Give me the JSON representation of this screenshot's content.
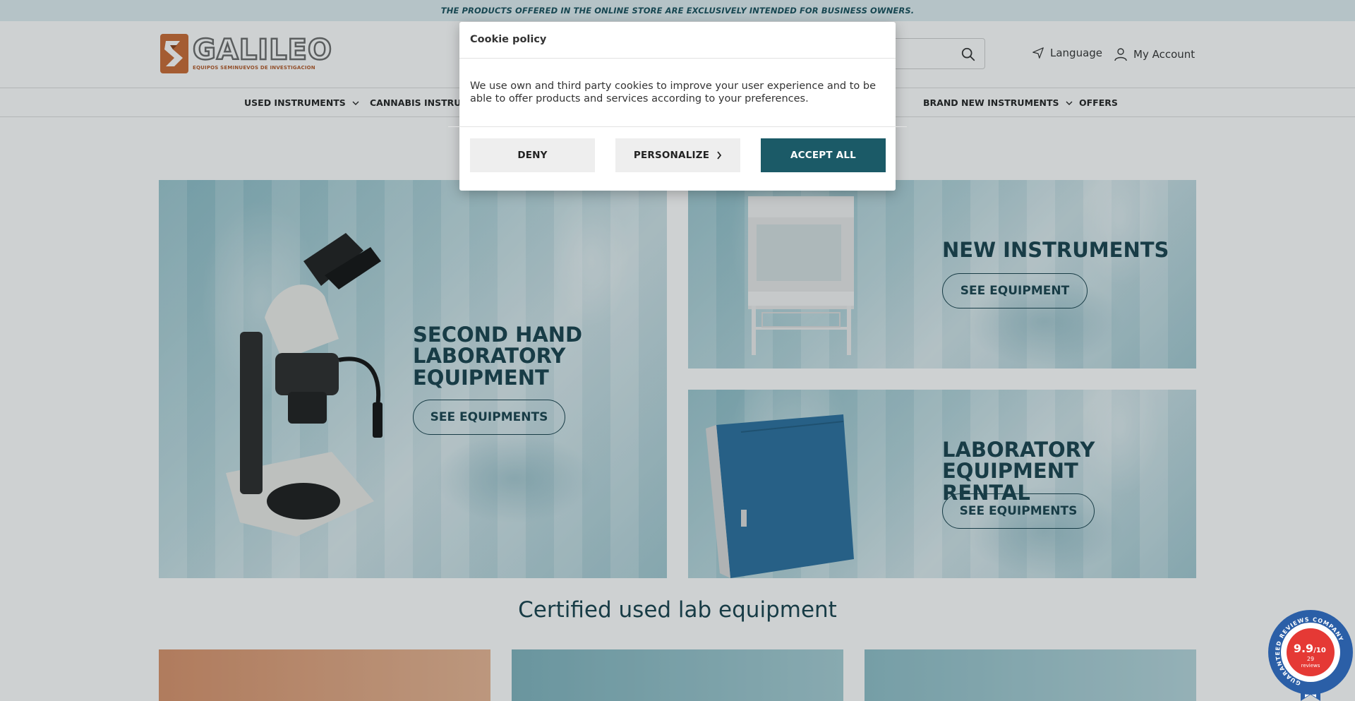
{
  "notice": {
    "text": "THE PRODUCTS OFFERED IN THE ONLINE STORE ARE EXCLUSIVELY INTENDED FOR BUSINESS OWNERS."
  },
  "header": {
    "logo_name": "GALILEO",
    "logo_tagline": "EQUIPOS SEMINUEVOS DE INVESTIGACION",
    "language_label": "Language",
    "account_label": "My Account"
  },
  "nav": {
    "items": [
      {
        "label": "USED INSTRUMENTS"
      },
      {
        "label": "CANNABIS INSTRUME"
      },
      {
        "label": "BRAND NEW INSTRUMENTS"
      },
      {
        "label": "OFFERS"
      }
    ]
  },
  "banners": [
    {
      "title": "SECOND HAND LABORATORY EQUIPMENT",
      "button": "SEE EQUIPMENTS"
    },
    {
      "title": "NEW INSTRUMENTS",
      "button": "SEE EQUIPMENT"
    },
    {
      "title": "LABORATORY EQUIPMENT RENTAL",
      "button": "SEE EQUIPMENTS"
    }
  ],
  "section": {
    "title": "Certified used lab equipment"
  },
  "badge": {
    "score": "9.9",
    "scale": "/10",
    "count": "29",
    "count_label": "reviews",
    "ring_text": "GUARANTEED REVIEWS COMPANY"
  },
  "cookie": {
    "title": "Cookie policy",
    "body": "We use own and third party cookies to improve your user experience and to be able to offer products and services according to your preferences.",
    "deny": "DENY",
    "personalize": "PERSONALIZE",
    "accept": "ACCEPT ALL"
  },
  "colors": {
    "brand_dark": "#1b5a67",
    "title_teal": "#17414c",
    "logo_orange": "#b45a2a"
  }
}
